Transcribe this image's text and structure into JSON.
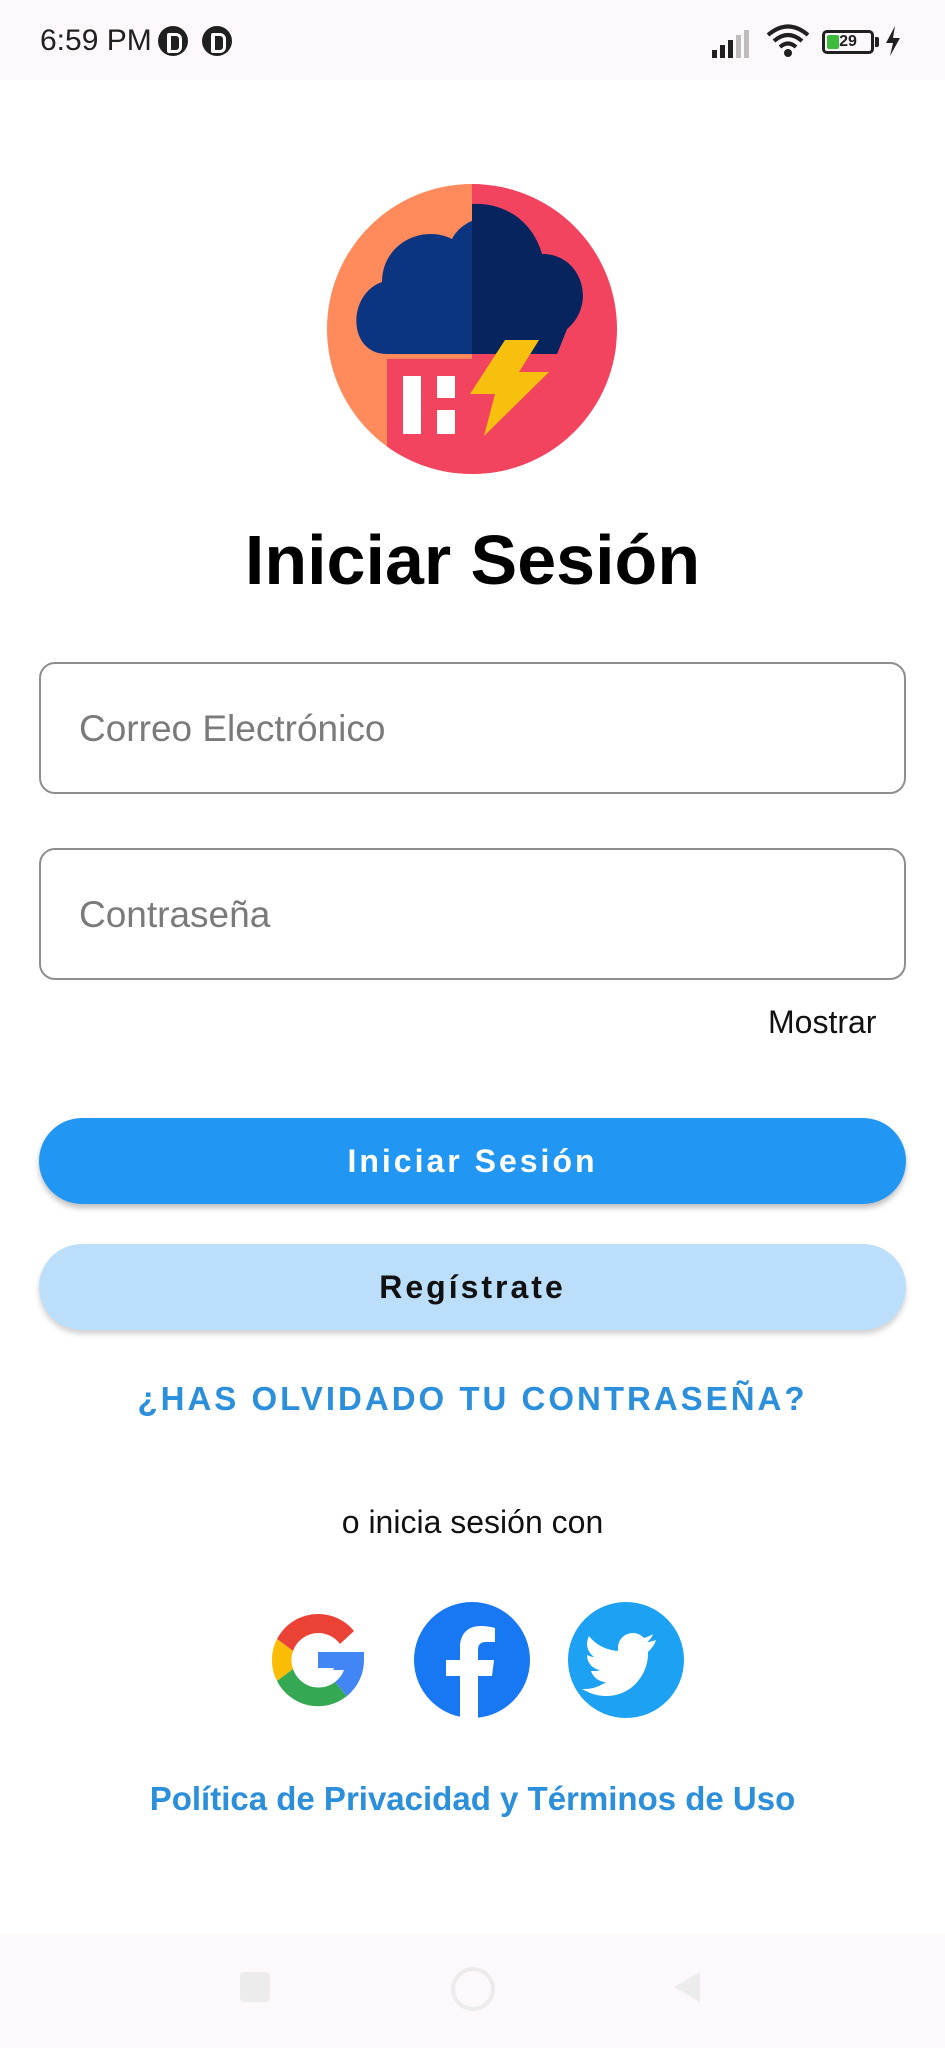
{
  "status_bar": {
    "time": "6:59 PM",
    "battery_level": "29",
    "battery_fraction": 0.29,
    "icons": [
      "app-notification-icon",
      "app-notification-icon",
      "signal-icon",
      "wifi-icon",
      "battery-icon",
      "charging-icon"
    ]
  },
  "logo": {
    "icon": "storm-cloud-logo",
    "colors": {
      "circle_left": "#ff8a5b",
      "circle_right": "#f2435f",
      "cloud": "#0b3580",
      "cloud_shade": "#07245e",
      "bolt": "#f7c00f"
    }
  },
  "title": "Iniciar Sesión",
  "form": {
    "email_placeholder": "Correo Electrónico",
    "email_value": "",
    "password_placeholder": "Contraseña",
    "password_value": "",
    "show_password_label": "Mostrar"
  },
  "buttons": {
    "login_label": "Iniciar Sesión",
    "register_label": "Regístrate"
  },
  "forgot_password_label": "¿HAS OLVIDADO TU CONTRASEÑA?",
  "alt_login_text": "o inicia sesión con",
  "social": [
    {
      "name": "Google",
      "icon": "google-icon"
    },
    {
      "name": "Facebook",
      "icon": "facebook-icon",
      "color": "#1877f2"
    },
    {
      "name": "Twitter",
      "icon": "twitter-icon",
      "color": "#1da1f2"
    }
  ],
  "privacy_link_label": "Política de Privacidad y Términos de Uso",
  "accent_colors": {
    "primary": "#2196f3",
    "secondary": "#bbdefb",
    "link": "#2b8fdc"
  },
  "nav_bar": {
    "icons": [
      "recents-icon",
      "home-icon",
      "back-icon"
    ]
  }
}
